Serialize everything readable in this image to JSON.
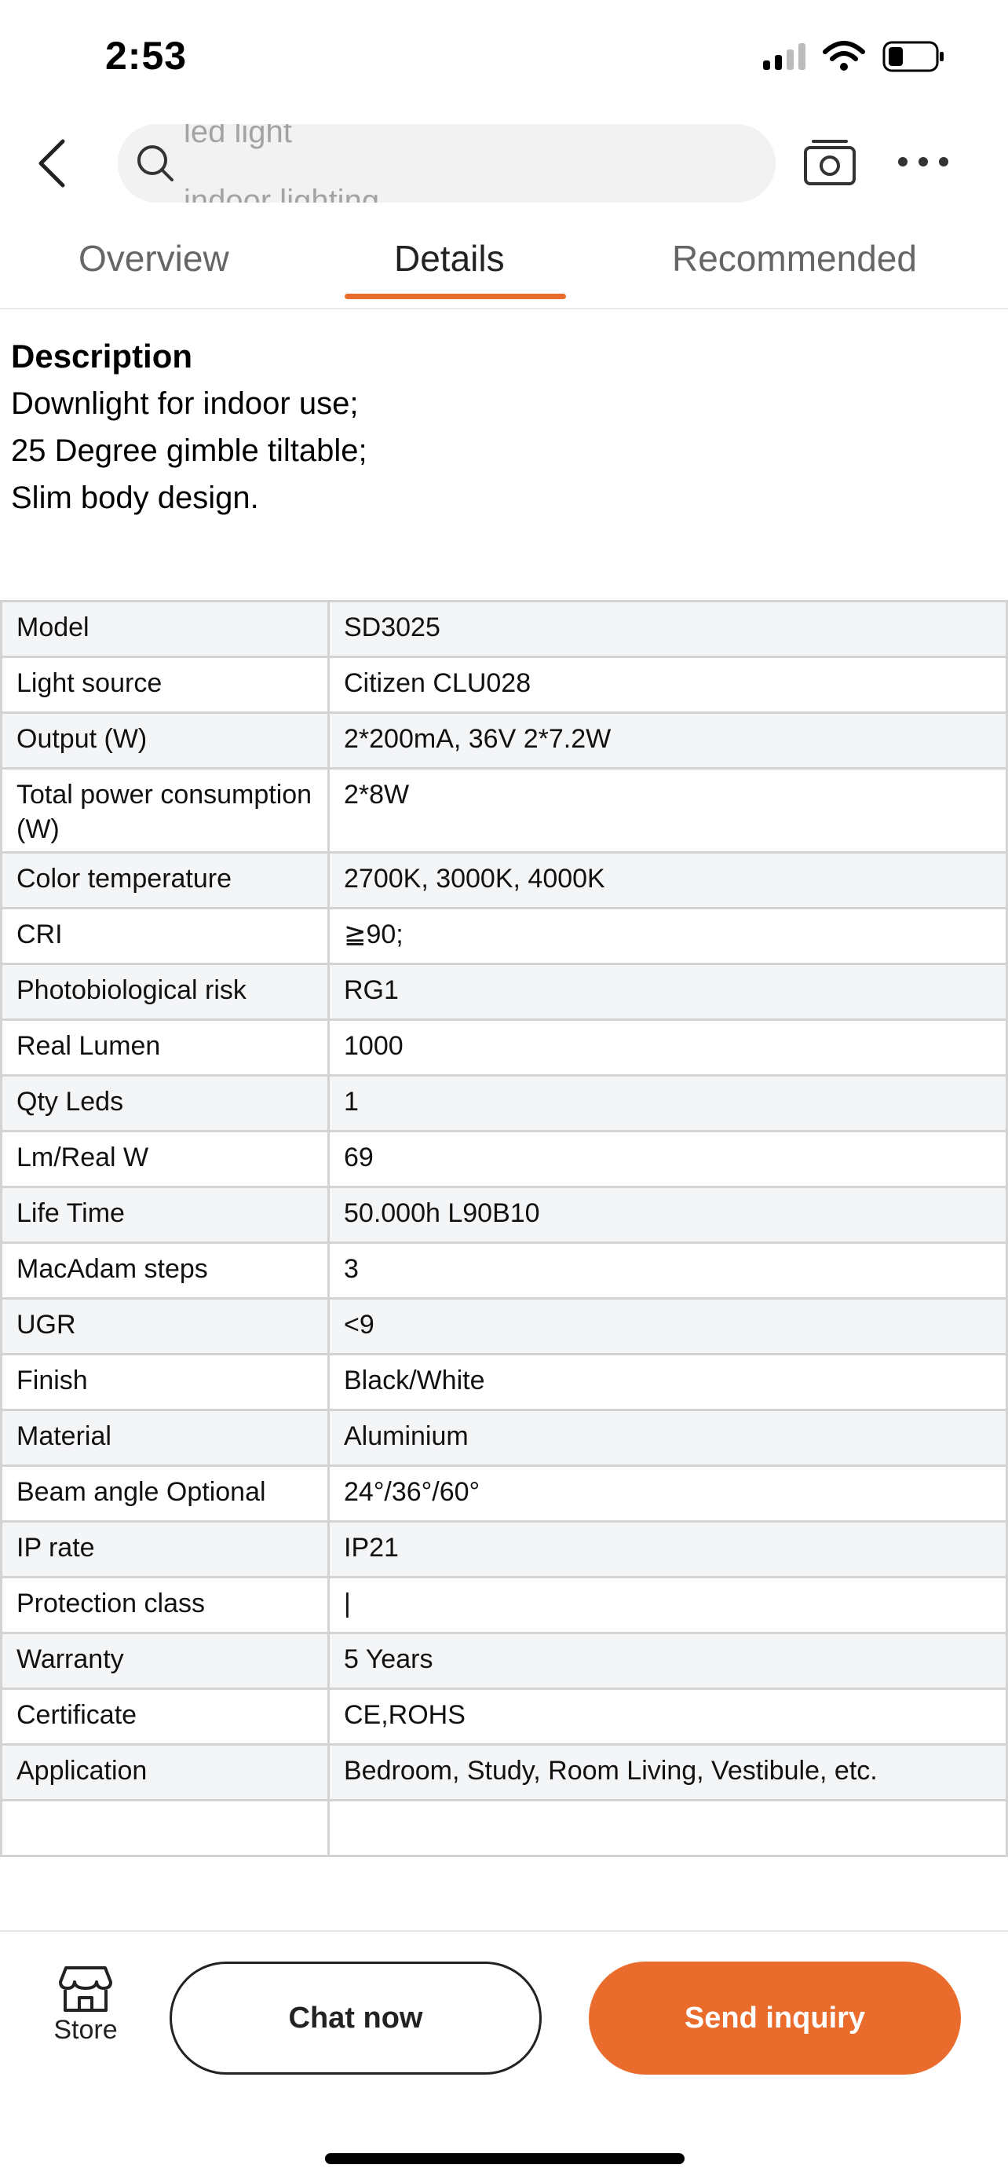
{
  "status_bar": {
    "time": "2:53"
  },
  "search": {
    "hint_top": "led light",
    "hint_bottom": "indoor lighting"
  },
  "tabs": [
    {
      "label": "Overview"
    },
    {
      "label": "Details"
    },
    {
      "label": "Recommended"
    }
  ],
  "active_tab": "Details",
  "description": {
    "title": "Description",
    "lines": [
      "Downlight for indoor use;",
      "25 Degree gimble tiltable;",
      "Slim body design."
    ]
  },
  "specs": [
    {
      "label": "Model",
      "value": "SD3025"
    },
    {
      "label": "Light source",
      "value": "Citizen CLU028"
    },
    {
      "label": "Output (W)",
      "value": "2*200mA, 36V 2*7.2W"
    },
    {
      "label": "Total power consumption (W)",
      "value": "2*8W"
    },
    {
      "label": "Color temperature",
      "value": "2700K, 3000K, 4000K"
    },
    {
      "label": "CRI",
      "value": "≧90;"
    },
    {
      "label": "Photobiological risk",
      "value": "RG1"
    },
    {
      "label": "Real Lumen",
      "value": "1000"
    },
    {
      "label": "Qty Leds",
      "value": "1"
    },
    {
      "label": "Lm/Real W",
      "value": "69"
    },
    {
      "label": "Life Time",
      "value": "50.000h L90B10"
    },
    {
      "label": "MacAdam steps",
      "value": "3"
    },
    {
      "label": "UGR",
      "value": "<9"
    },
    {
      "label": "Finish",
      "value": "Black/White"
    },
    {
      "label": "Material",
      "value": "Aluminium"
    },
    {
      "label": "Beam angle Optional",
      "value": "24°/36°/60°"
    },
    {
      "label": "IP rate",
      "value": "IP21"
    },
    {
      "label": "Protection class",
      "value": "|"
    },
    {
      "label": "Warranty",
      "value": "5 Years"
    },
    {
      "label": "Certificate",
      "value": "CE,ROHS"
    },
    {
      "label": "Application",
      "value": "Bedroom, Study, Room Living, Vestibule, etc."
    },
    {
      "label": "",
      "value": ""
    }
  ],
  "bottom_bar": {
    "store_label": "Store",
    "chat_label": "Chat now",
    "inquiry_label": "Send inquiry"
  },
  "colors": {
    "accent": "#ea6c2d",
    "row_alt": "#f4f5f7",
    "border": "#d3d3d3"
  },
  "icons": [
    "back-arrow-icon",
    "search-icon",
    "camera-icon",
    "more-icon",
    "store-icon",
    "signal-icon",
    "wifi-icon",
    "battery-icon"
  ]
}
